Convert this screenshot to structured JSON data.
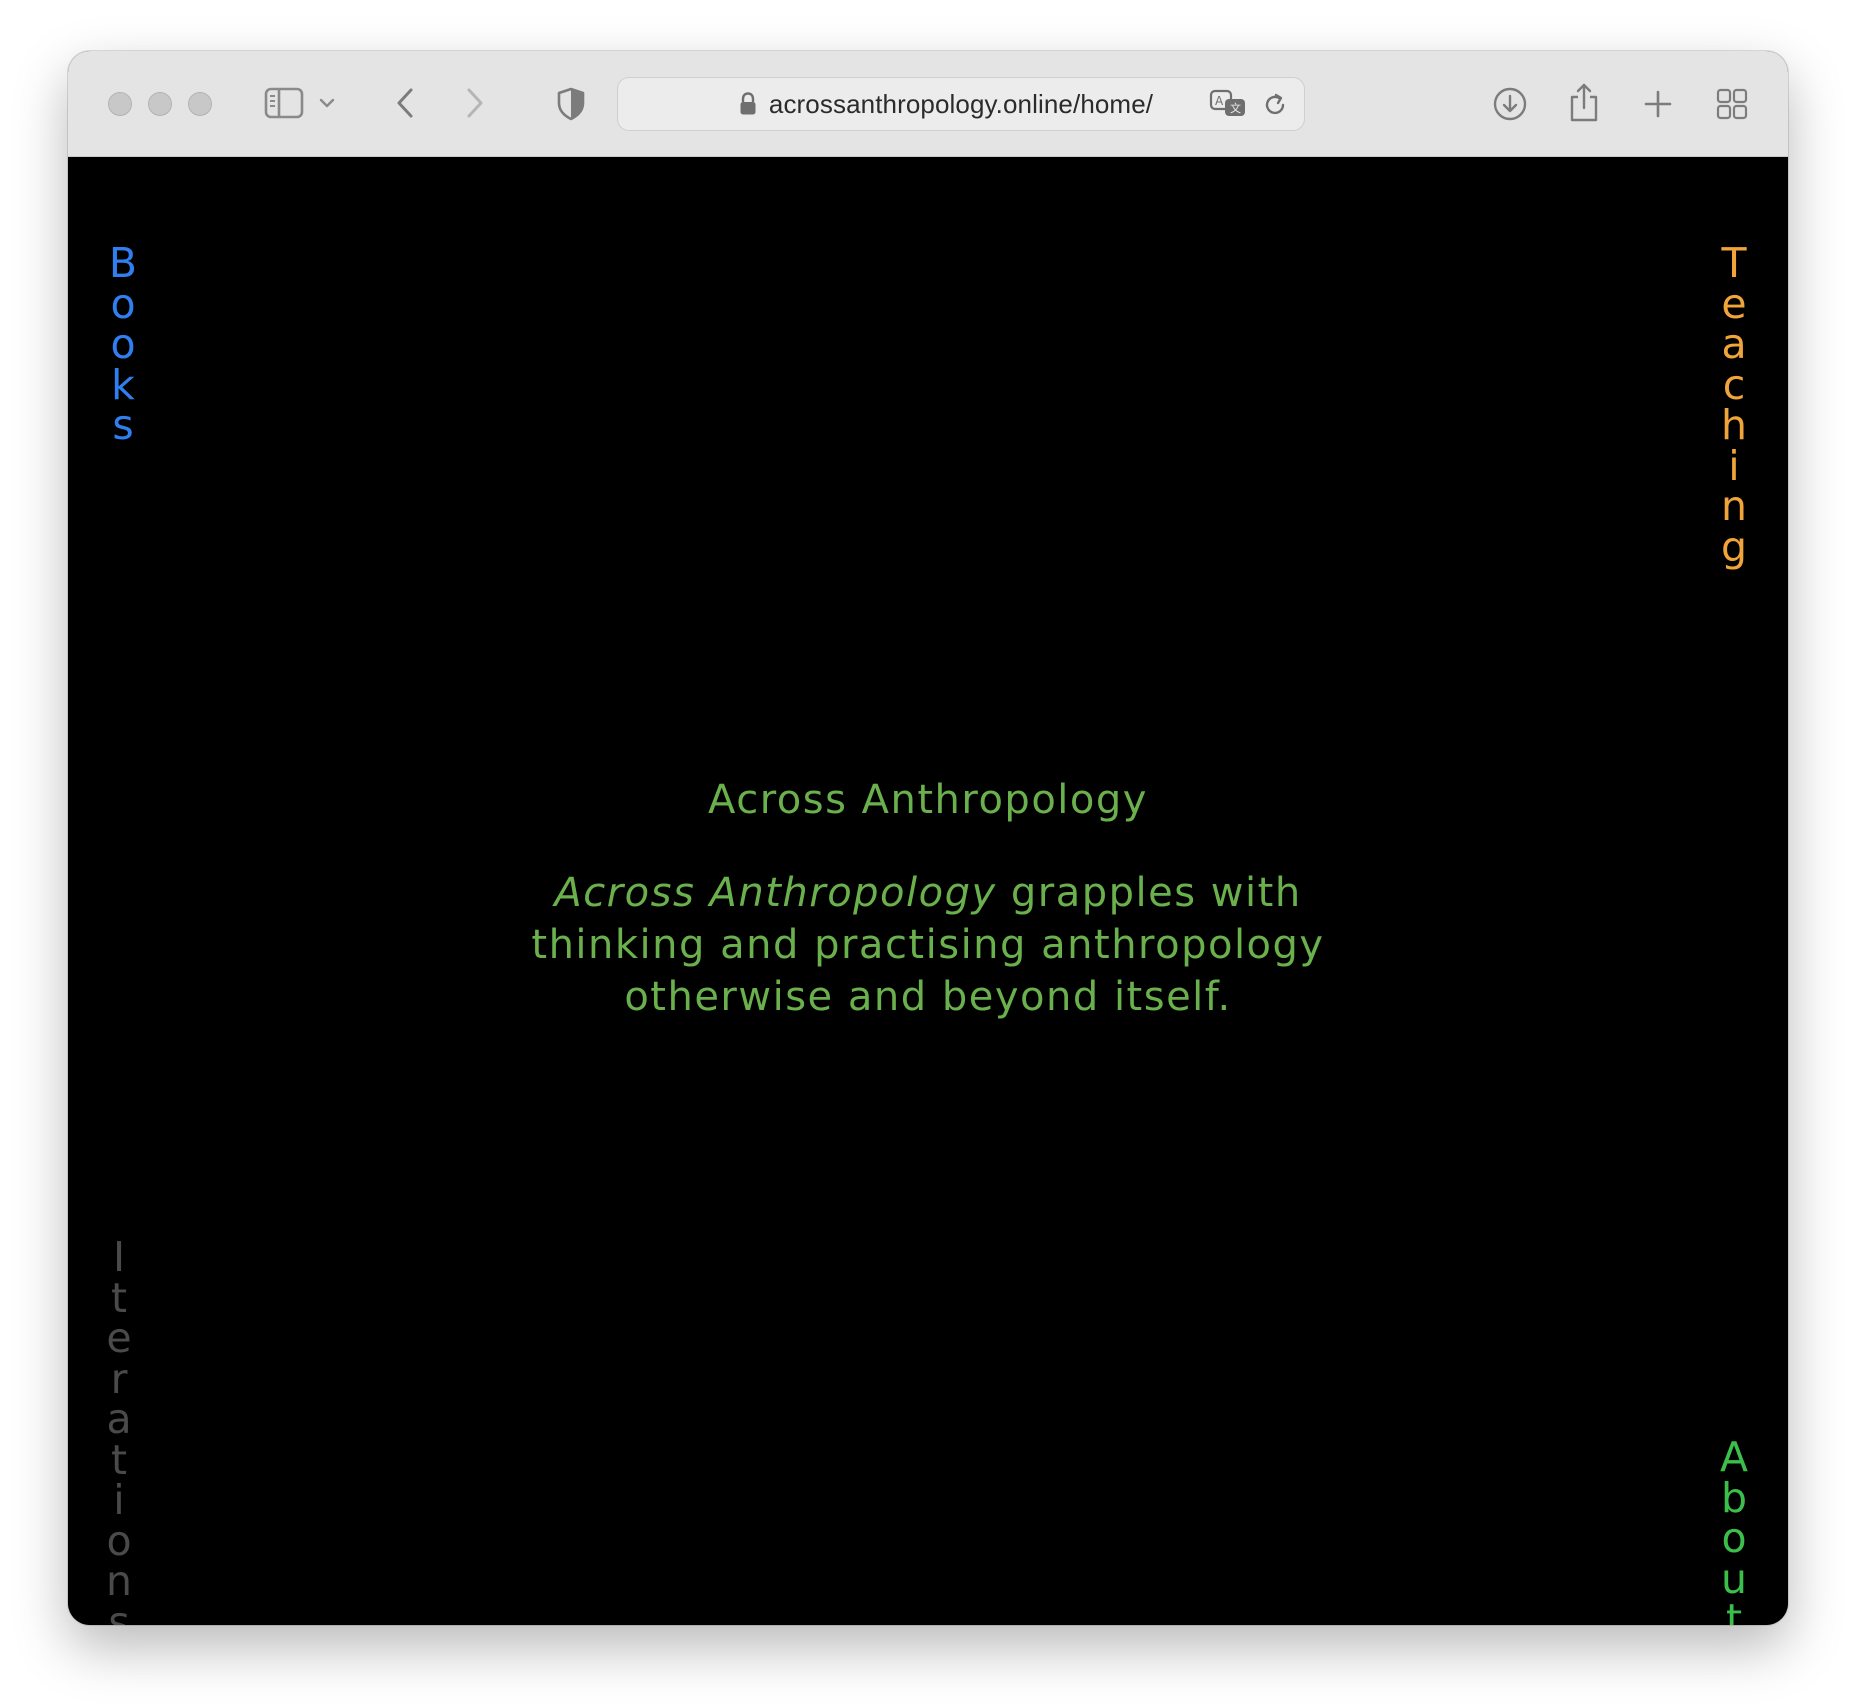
{
  "browser": {
    "url": "acrossanthropology.online/home/"
  },
  "nav": {
    "books": {
      "label": "Books",
      "color": "#2f7ff0"
    },
    "teaching": {
      "label": "Teaching",
      "color": "#f0a53a"
    },
    "iterations": {
      "label": "Iterations",
      "color": "#4a4a4a"
    },
    "about": {
      "label": "About",
      "color": "#3cbf4a"
    }
  },
  "hero": {
    "title": "Across Anthropology",
    "blurb_italic": "Across Anthropology",
    "blurb_line1_rest": " grapples with",
    "blurb_line2": "thinking and practising anthropology",
    "blurb_line3": "otherwise and beyond itself.",
    "color": "#6ab04c"
  }
}
